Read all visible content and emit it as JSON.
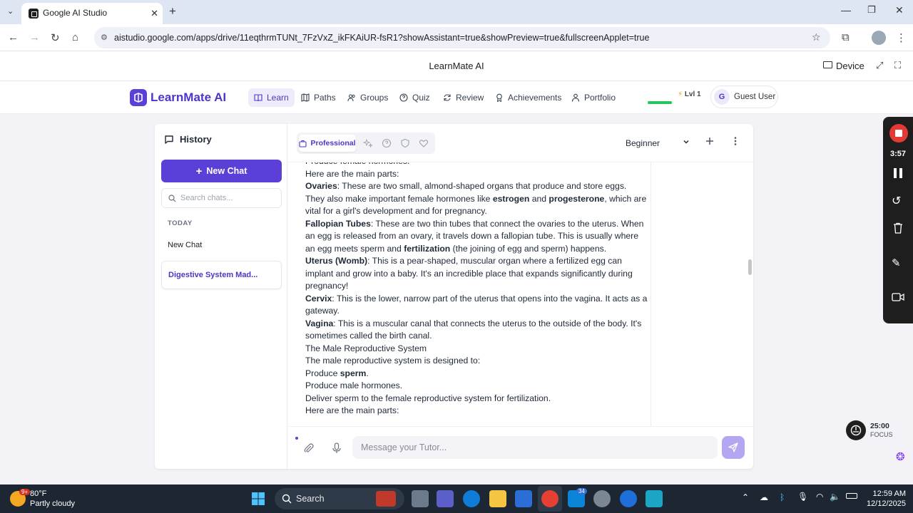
{
  "browser": {
    "tab_title": "Google AI Studio",
    "url": "aistudio.google.com/apps/drive/11eqthrmTUNt_7FzVxZ_ikFKAiUR-fsR1?showAssistant=true&showPreview=true&fullscreenApplet=true"
  },
  "studio": {
    "app_title": "LearnMate AI",
    "device_label": "Device"
  },
  "app": {
    "logo": "LearnMate AI",
    "nav": [
      {
        "label": "Learn",
        "icon": "book-icon"
      },
      {
        "label": "Paths",
        "icon": "map-icon"
      },
      {
        "label": "Groups",
        "icon": "users-icon"
      },
      {
        "label": "Quiz",
        "icon": "help-circle-icon"
      },
      {
        "label": "Review",
        "icon": "refresh-icon"
      },
      {
        "label": "Achievements",
        "icon": "award-icon"
      },
      {
        "label": "Portfolio",
        "icon": "user-icon"
      }
    ],
    "level": "Lvl 1",
    "user": {
      "initial": "G",
      "name": "Guest User"
    }
  },
  "history": {
    "title": "History",
    "new_chat": "New Chat",
    "search_placeholder": "Search chats...",
    "section": "TODAY",
    "items": [
      "New Chat",
      "Digestive System Mad..."
    ]
  },
  "chat": {
    "mode": "Professional",
    "level_select": "Beginner",
    "input_placeholder": "Message your Tutor...",
    "lines": [
      [
        {
          "t": "Produce female hormones."
        }
      ],
      [
        {
          "t": "Here are the main parts:"
        }
      ],
      [
        {
          "t": "Ovaries",
          "b": true
        },
        {
          "t": ": These are two small, almond-shaped organs that produce and store eggs. They also make important female hormones like "
        },
        {
          "t": "estrogen",
          "b": true
        },
        {
          "t": " and "
        },
        {
          "t": "progesterone",
          "b": true
        },
        {
          "t": ", which are vital for a girl's development and for pregnancy."
        }
      ],
      [
        {
          "t": "Fallopian Tubes",
          "b": true
        },
        {
          "t": ": These are two thin tubes that connect the ovaries to the uterus. When an egg is released from an ovary, it travels down a fallopian tube. This is usually where an egg meets sperm and "
        },
        {
          "t": "fertilization",
          "b": true
        },
        {
          "t": " (the joining of egg and sperm) happens."
        }
      ],
      [
        {
          "t": "Uterus (Womb)",
          "b": true
        },
        {
          "t": ": This is a pear-shaped, muscular organ where a fertilized egg can implant and grow into a baby. It's an incredible place that expands significantly during pregnancy!"
        }
      ],
      [
        {
          "t": "Cervix",
          "b": true
        },
        {
          "t": ": This is the lower, narrow part of the uterus that opens into the vagina. It acts as a gateway."
        }
      ],
      [
        {
          "t": "Vagina",
          "b": true
        },
        {
          "t": ": This is a muscular canal that connects the uterus to the outside of the body. It's sometimes called the birth canal."
        }
      ],
      [
        {
          "t": "The Male Reproductive System"
        }
      ],
      [
        {
          "t": "The male reproductive system is designed to:"
        }
      ],
      [
        {
          "t": "Produce "
        },
        {
          "t": "sperm",
          "b": true
        },
        {
          "t": "."
        }
      ],
      [
        {
          "t": "Produce male hormones."
        }
      ],
      [
        {
          "t": "Deliver sperm to the female reproductive system for fertilization."
        }
      ],
      [
        {
          "t": "Here are the main parts:"
        }
      ]
    ]
  },
  "recorder": {
    "time": "3:57"
  },
  "focus": {
    "time": "25:00",
    "label": "FOCUS"
  },
  "taskbar": {
    "weather_temp": "80°F",
    "weather_desc": "Partly cloudy",
    "weather_badge": "9+",
    "search_label": "Search",
    "notif_count": "34",
    "time": "12:59 AM",
    "date": "12/12/2025"
  },
  "colors": {
    "accent": "#5b3fd6",
    "send_button": "#b4a6f0",
    "taskbar": "#1c2733"
  }
}
